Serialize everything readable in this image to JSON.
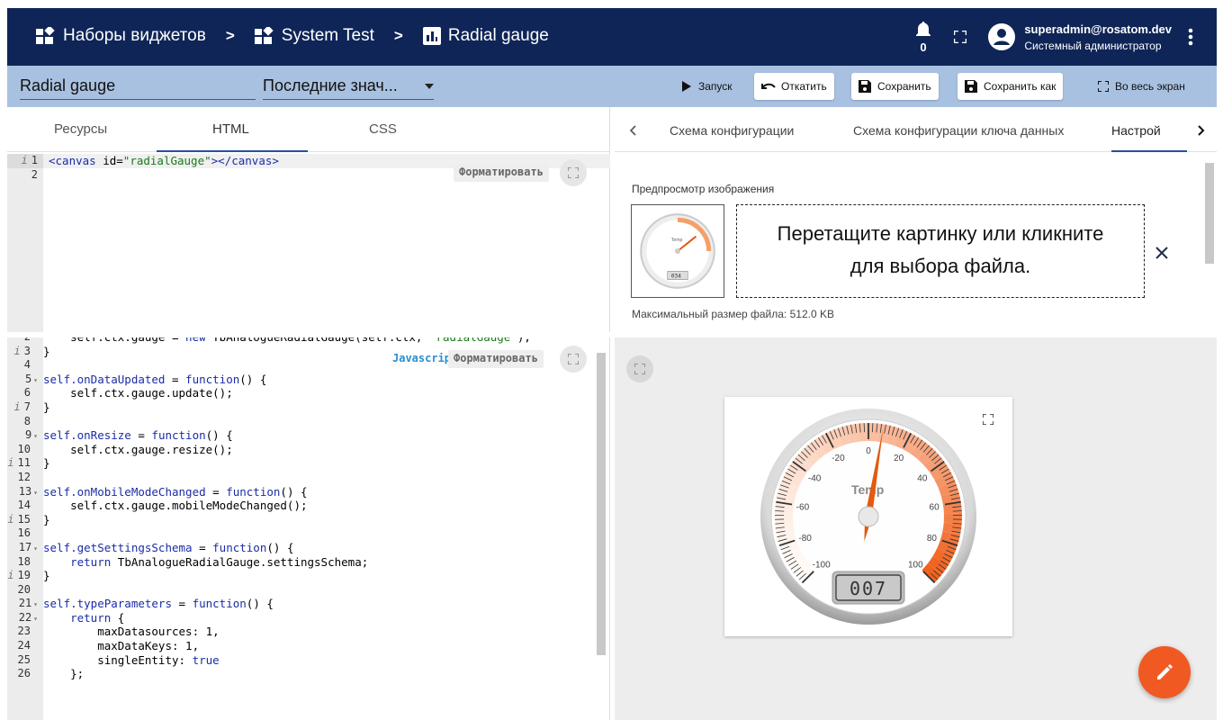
{
  "breadcrumbs": [
    {
      "label": "Наборы виджетов"
    },
    {
      "label": "System Test"
    },
    {
      "label": "Radial gauge"
    }
  ],
  "breadcrumb_separator": ">",
  "notifications": {
    "count": "0"
  },
  "user": {
    "email": "superadmin@rosatom.dev",
    "role": "Системный администратор"
  },
  "widget_editor": {
    "name_value": "Radial gauge",
    "type_select_value": "Последние знач...",
    "run_label": "Запуск",
    "undo_label": "Откатить",
    "save_label": "Сохранить",
    "save_as_label": "Сохранить как",
    "fullscreen_label": "Во весь экран"
  },
  "left_tabs": [
    "Ресурсы",
    "HTML",
    "CSS"
  ],
  "html_editor": {
    "line_numbers": [
      "1",
      "2"
    ],
    "format_label": "Форматировать"
  },
  "js_editor": {
    "mode_label": "Javascript",
    "format_label": "Форматировать",
    "line_numbers": [
      "2",
      "3",
      "4",
      "5",
      "6",
      "7",
      "8",
      "9",
      "10",
      "11",
      "12",
      "13",
      "14",
      "15",
      "16",
      "17",
      "18",
      "19",
      "20",
      "21",
      "22",
      "23",
      "24",
      "25",
      "26"
    ],
    "info_lines": [
      "3",
      "7",
      "11",
      "15",
      "19"
    ],
    "fold_lines": [
      "5",
      "9",
      "13",
      "17",
      "21",
      "22"
    ]
  },
  "right_tabs": [
    "Схема конфигурации",
    "Схема конфигурации ключа данных",
    "Настрой"
  ],
  "image_preview": {
    "label": "Предпросмотр изображения",
    "dropzone_line1": "Перетащите картинку или кликните",
    "dropzone_line2": "для выбора файла.",
    "max_size": "Максимальный размер файла: 512.0 KB",
    "thumb_value": "034",
    "thumb_title": "Temp"
  },
  "gauge": {
    "title": "Temp",
    "value": "007",
    "min": -100,
    "max": 100,
    "major_ticks": [
      "-100",
      "-80",
      "-60",
      "-40",
      "-20",
      "0",
      "20",
      "40",
      "60",
      "80",
      "100"
    ],
    "needle_value": 7,
    "colors": {
      "highlight_start": "#fbe3d3",
      "highlight_end": "#f05a14",
      "needle": "#e35a10"
    }
  },
  "colors": {
    "topbar": "#0f2557",
    "subbar": "#a9c1e0",
    "fab": "#f05a22",
    "accent": "#2a4f9c"
  }
}
